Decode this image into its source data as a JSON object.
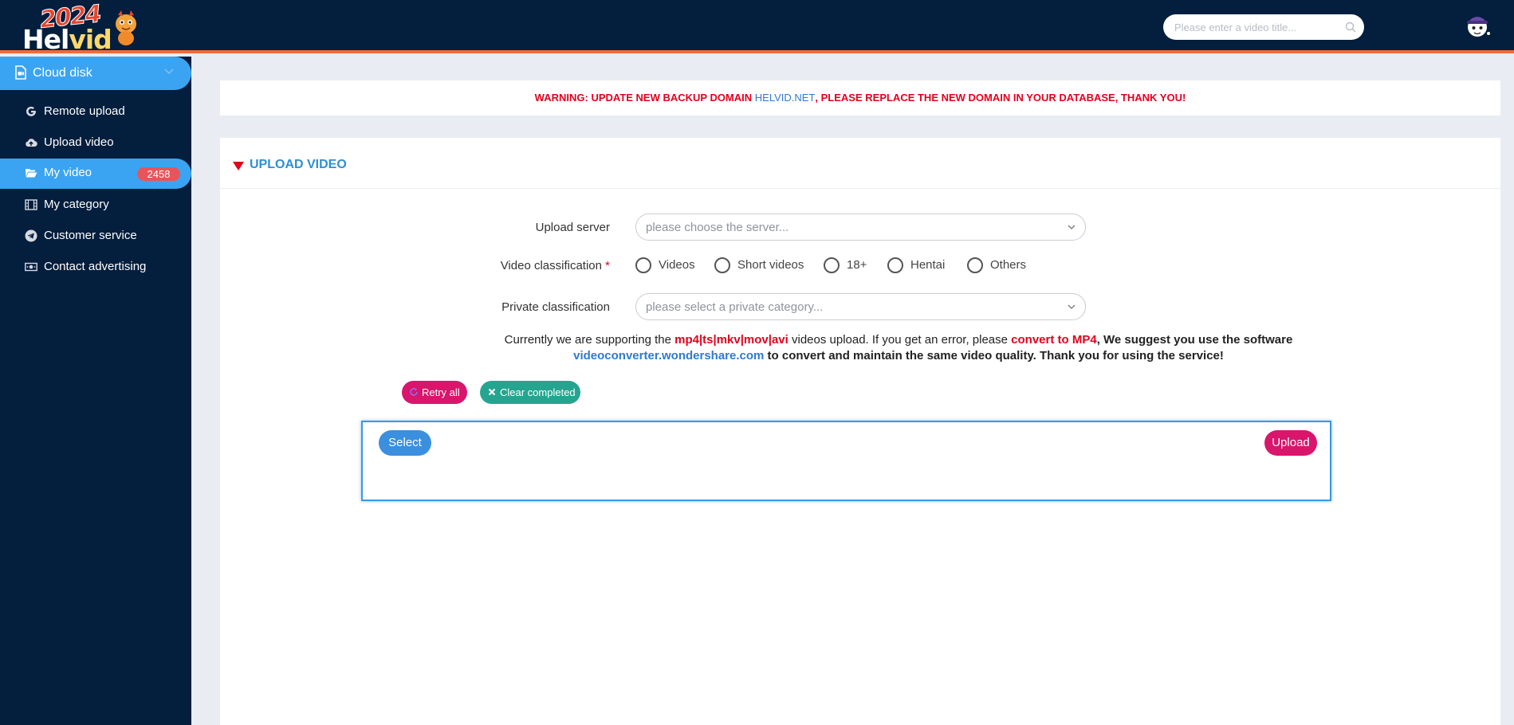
{
  "header": {
    "logo": {
      "year": "2024",
      "brand_part1": "Hel",
      "brand_part2": "vid"
    },
    "search_placeholder": "Please enter a video title...",
    "colors": {
      "background": "#041e3d",
      "accent_line": "#f26a3b"
    }
  },
  "sidebar": {
    "section": {
      "label": "Cloud disk",
      "icon": "file-video-icon"
    },
    "items": [
      {
        "label": "Remote upload",
        "icon": "google-g-icon",
        "active": false
      },
      {
        "label": "Upload video",
        "icon": "cloud-upload-icon",
        "active": false
      },
      {
        "label": "My video",
        "icon": "folder-open-icon",
        "active": true,
        "badge": "2458"
      },
      {
        "label": "My category",
        "icon": "film-icon",
        "active": false
      },
      {
        "label": "Customer service",
        "icon": "telegram-icon",
        "active": false
      },
      {
        "label": "Contact advertising",
        "icon": "money-bill-icon",
        "active": false
      }
    ]
  },
  "warning": {
    "part1": "WARNING: UPDATE NEW BACKUP DOMAIN ",
    "domain": "HELVID.NET",
    "part2": ", PLEASE REPLACE THE NEW DOMAIN IN YOUR DATABASE, THANK YOU!"
  },
  "upload": {
    "title": "UPLOAD VIDEO",
    "server_label": "Upload server",
    "server_placeholder": "please choose the server...",
    "classification_label": "Video classification",
    "required_mark": "*",
    "classifications": [
      "Videos",
      "Short videos",
      "18+",
      "Hentai",
      "Others"
    ],
    "private_label": "Private classification",
    "private_placeholder": "please select a private category...",
    "notice": {
      "t1": "Currently we are supporting the ",
      "formats": "mp4|ts|mkv|mov|avi",
      "t2": " videos upload. If you get an error, please ",
      "convert": "convert to MP4",
      "t3": ", We suggest you use the software",
      "link": "videoconverter.wondershare.com",
      "t4": " to convert and maintain the same video quality. Thank you for using the service!"
    },
    "retry_label": "Retry all",
    "clear_label": "Clear completed",
    "select_label": "Select",
    "upload_label": "Upload"
  }
}
